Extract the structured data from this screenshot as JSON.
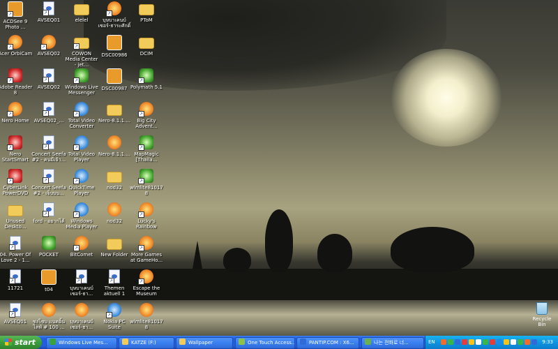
{
  "desktop": {
    "icons": [
      {
        "label": "ACDSee 9 Photo ...",
        "type": "photo",
        "shortcut": true
      },
      {
        "label": "AVSEQ01",
        "type": "file",
        "shortcut": true
      },
      {
        "label": "elelel",
        "type": "folder",
        "shortcut": false
      },
      {
        "label": "บุษบาเคนบ์ เซอร์-ธาระศักดิ์",
        "type": "app",
        "shortcut": true
      },
      {
        "label": "PToM",
        "type": "folder",
        "shortcut": false
      },
      {
        "label": "Acer OrbiCam",
        "type": "app",
        "shortcut": true
      },
      {
        "label": "AVSEQ02",
        "type": "app",
        "shortcut": true
      },
      {
        "label": "COWON Media Center - jet...",
        "type": "folder",
        "shortcut": true
      },
      {
        "label": "DSC00986",
        "type": "photo",
        "shortcut": false
      },
      {
        "label": "DCIM",
        "type": "folder",
        "shortcut": false
      },
      {
        "label": "Adobe Reader 8",
        "type": "red",
        "shortcut": true
      },
      {
        "label": "AVSEQ02",
        "type": "file",
        "shortcut": true
      },
      {
        "label": "Windows Live Messenger",
        "type": "green",
        "shortcut": true
      },
      {
        "label": "DSC00987",
        "type": "photo",
        "shortcut": false
      },
      {
        "label": "Polymath 5.1",
        "type": "green",
        "shortcut": true
      },
      {
        "label": "Nero Home",
        "type": "app",
        "shortcut": true
      },
      {
        "label": "AVSEQ02_...",
        "type": "file",
        "shortcut": true
      },
      {
        "label": "Total Video Converter",
        "type": "blue",
        "shortcut": true
      },
      {
        "label": "Nero-8.1.1....",
        "type": "folder",
        "shortcut": false
      },
      {
        "label": "Big City Advent...",
        "type": "app",
        "shortcut": true
      },
      {
        "label": "Nero StartSmart",
        "type": "red",
        "shortcut": true
      },
      {
        "label": "Concert Seefa #2 - คนมีเจ้า...",
        "type": "file",
        "shortcut": true
      },
      {
        "label": "Total Video Player",
        "type": "blue",
        "shortcut": true
      },
      {
        "label": "Nero-8.1.1....",
        "type": "app",
        "shortcut": false
      },
      {
        "label": "MapMagic [Thaila...",
        "type": "green",
        "shortcut": true
      },
      {
        "label": "CyberLink PowerDVD",
        "type": "red",
        "shortcut": true
      },
      {
        "label": "Concert Seefa #2 - เจ็บบน...",
        "type": "file",
        "shortcut": true
      },
      {
        "label": "QuickTime Player",
        "type": "blue",
        "shortcut": true
      },
      {
        "label": "nod32",
        "type": "folder",
        "shortcut": false
      },
      {
        "label": "wlmlite810178",
        "type": "green",
        "shortcut": true
      },
      {
        "label": "Unused Deskto...",
        "type": "folder",
        "shortcut": false
      },
      {
        "label": "ford - อยากได้",
        "type": "file",
        "shortcut": true
      },
      {
        "label": "Windows Media Player",
        "type": "blue",
        "shortcut": true
      },
      {
        "label": "nod32",
        "type": "app",
        "shortcut": false
      },
      {
        "label": "Lucky's Rainbow",
        "type": "app",
        "shortcut": true
      },
      {
        "label": "04. Power Of Love 2 - 1...",
        "type": "file",
        "shortcut": true
      },
      {
        "label": "POCKET",
        "type": "green",
        "shortcut": false
      },
      {
        "label": "BitComet",
        "type": "app",
        "shortcut": true
      },
      {
        "label": "New Folder",
        "type": "folder",
        "shortcut": false
      },
      {
        "label": "More Games at GameHo...",
        "type": "app",
        "shortcut": true
      },
      {
        "label": "11721",
        "type": "file",
        "shortcut": true
      },
      {
        "label": "t04",
        "type": "photo",
        "shortcut": false
      },
      {
        "label": "บุษบาเคนบ์ เซอร์-ธา...",
        "type": "file",
        "shortcut": true
      },
      {
        "label": "Themen aktuell 1",
        "type": "file",
        "shortcut": true
      },
      {
        "label": "Escape the Museum",
        "type": "app",
        "shortcut": true
      },
      {
        "label": "AVSEQ01",
        "type": "file",
        "shortcut": true
      },
      {
        "label": "ชงโซบ แนคอิ้น ไลฟ์ # 100 ...",
        "type": "app",
        "shortcut": false
      },
      {
        "label": "บุษบาเคนบ์ เซอร์-ธา...",
        "type": "app",
        "shortcut": false
      },
      {
        "label": "Nokia PC Suite",
        "type": "blue",
        "shortcut": true
      },
      {
        "label": "wlmlite810178",
        "type": "app",
        "shortcut": false
      }
    ],
    "recycle_bin": {
      "label": "Recycle Bin"
    }
  },
  "taskbar": {
    "start_label": "start",
    "tasks": [
      {
        "label": "Windows Live Mes...",
        "color": "#3aa23a"
      },
      {
        "label": "KATZE (F:)",
        "color": "#f2cc5b"
      },
      {
        "label": "Wallpaper",
        "color": "#f2cc5b"
      },
      {
        "label": "One Touch Access...",
        "color": "#8bc34a"
      },
      {
        "label": "PANTIP.COM : X6...",
        "color": "#2f6ad6"
      },
      {
        "label": "나는 전화로 너...",
        "color": "#6ab04c"
      }
    ],
    "tray": {
      "language": "EN",
      "clock": "9:33",
      "icons": [
        "#f36b2a",
        "#3ab54a",
        "#2f6ad6",
        "#e23c3c",
        "#f6c31c",
        "#ffffff",
        "#3ab54a",
        "#e23c3c",
        "#1e88e5",
        "#f6c31c",
        "#ffffff",
        "#3ab54a",
        "#f36b2a",
        "#2f6ad6"
      ]
    }
  }
}
